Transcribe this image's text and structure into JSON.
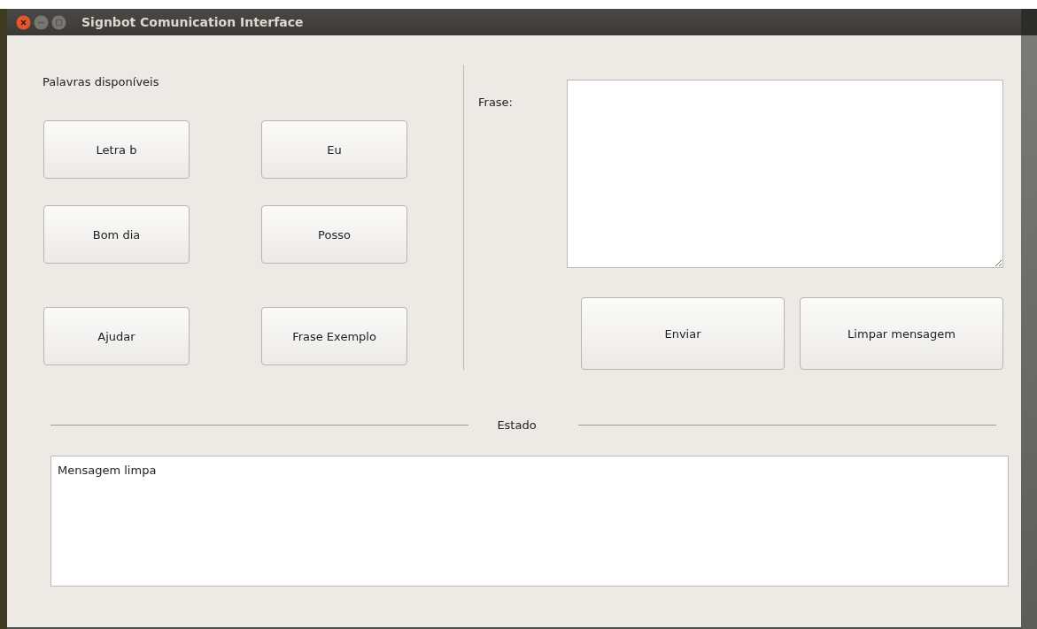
{
  "window": {
    "title": "Signbot Comunication Interface"
  },
  "words": {
    "label": "Palavras disponíveis",
    "buttons": [
      "Letra b",
      "Eu",
      "Bom dia",
      "Posso",
      "Ajudar",
      "Frase Exemplo"
    ]
  },
  "phrase": {
    "label": "Frase:"
  },
  "actions": [
    "Enviar",
    "Limpar mensagem"
  ],
  "status": {
    "label": "Estado",
    "text": "Mensagem limpa"
  }
}
